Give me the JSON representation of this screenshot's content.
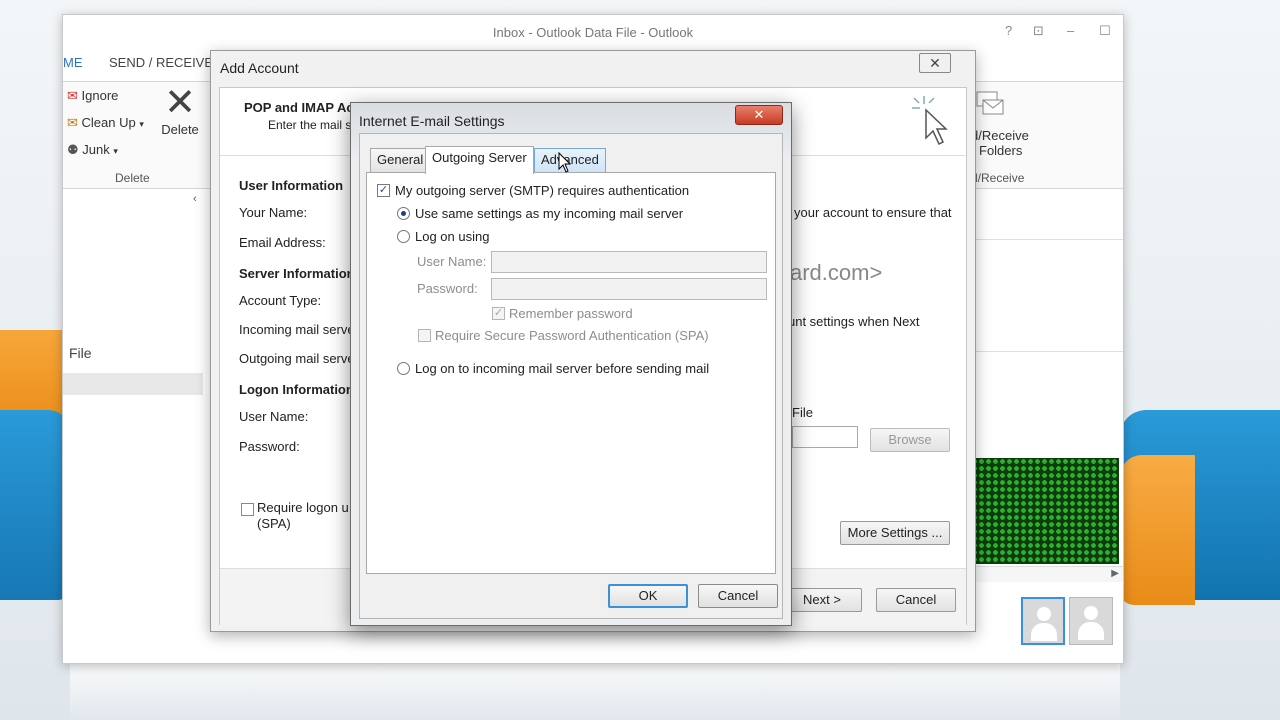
{
  "outlook": {
    "title": "Inbox - Outlook Data File - Outlook",
    "controls": {
      "help": "?",
      "restore": "⊡",
      "minimize": "–",
      "maximize": "☐"
    },
    "tabs": {
      "home": "ME",
      "send_receive": "SEND / RECEIVE"
    },
    "ribbon": {
      "ignore": "Ignore",
      "clean_up": "Clean Up",
      "junk": "Junk",
      "delete": "Delete",
      "delete_group": "Delete",
      "send_receive_folders_1": "d/Receive",
      "send_receive_folders_2": "Folders",
      "send_receive_group": "d/Receive"
    },
    "sidebar": {
      "file": "File",
      "collapse": "‹"
    }
  },
  "add_account": {
    "title": "Add Account",
    "close": "✕",
    "header_title": "POP and IMAP Ac",
    "header_sub": "Enter the mail s",
    "labels": {
      "user_information": "User Information",
      "your_name": "Your Name:",
      "email_address": "Email Address:",
      "server_information": "Server Information",
      "account_type": "Account Type:",
      "incoming": "Incoming mail serve",
      "outgoing": "Outgoing mail serve",
      "logon_information": "Logon Information",
      "user_name": "User Name:",
      "password": "Password:",
      "require_logon_1": "Require logon u",
      "require_logon_2": "(SPA)"
    },
    "right_text": {
      "ensure": "your account to ensure that",
      "domain": "ard.com>",
      "settings_next": "unt settings when Next",
      "file": "File"
    },
    "buttons": {
      "browse": "Browse",
      "more_settings": "More Settings ...",
      "next": "Next >",
      "cancel": "Cancel"
    }
  },
  "internet_email_settings": {
    "title": "Internet E-mail Settings",
    "close": "✕",
    "tabs": {
      "general": "General",
      "outgoing_server": "Outgoing Server",
      "advanced": "Advanced"
    },
    "outgoing": {
      "smtp_auth": "My outgoing server (SMTP) requires authentication",
      "use_same": "Use same settings as my incoming mail server",
      "log_on_using": "Log on using",
      "user_name_label": "User Name:",
      "password_label": "Password:",
      "user_name_value": "",
      "password_value": "",
      "remember_password": "Remember password",
      "require_spa": "Require Secure Password Authentication (SPA)",
      "log_on_incoming": "Log on to incoming mail server before sending mail"
    },
    "buttons": {
      "ok": "OK",
      "cancel": "Cancel"
    }
  }
}
